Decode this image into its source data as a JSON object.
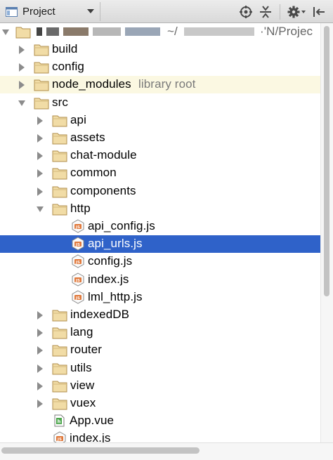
{
  "toolbar": {
    "view_title": "Project",
    "icons": [
      "project-window-icon",
      "chevron-down-icon",
      "crosshair-icon",
      "collapse-icon",
      "gear-icon",
      "hide-icon"
    ]
  },
  "tree": {
    "root_visible_suffix": "~/",
    "root_visible_tail": "·'N/Projec",
    "items": [
      {
        "label": "build",
        "type": "folder",
        "state": "collapsed"
      },
      {
        "label": "config",
        "type": "folder",
        "state": "collapsed"
      },
      {
        "label": "node_modules",
        "hint": "library root",
        "type": "folder",
        "state": "collapsed",
        "highlighted": true
      },
      {
        "label": "src",
        "type": "folder",
        "state": "expanded"
      },
      {
        "label": "api",
        "type": "folder",
        "state": "collapsed"
      },
      {
        "label": "assets",
        "type": "folder",
        "state": "collapsed"
      },
      {
        "label": "chat-module",
        "type": "folder",
        "state": "collapsed"
      },
      {
        "label": "common",
        "type": "folder",
        "state": "collapsed"
      },
      {
        "label": "components",
        "type": "folder",
        "state": "collapsed"
      },
      {
        "label": "http",
        "type": "folder",
        "state": "expanded"
      },
      {
        "label": "api_config.js",
        "type": "js"
      },
      {
        "label": "api_urls.js",
        "type": "js",
        "selected": true
      },
      {
        "label": "config.js",
        "type": "js"
      },
      {
        "label": "index.js",
        "type": "js"
      },
      {
        "label": "lml_http.js",
        "type": "js"
      },
      {
        "label": "indexedDB",
        "type": "folder",
        "state": "collapsed"
      },
      {
        "label": "lang",
        "type": "folder",
        "state": "collapsed"
      },
      {
        "label": "router",
        "type": "folder",
        "state": "collapsed"
      },
      {
        "label": "utils",
        "type": "folder",
        "state": "collapsed"
      },
      {
        "label": "view",
        "type": "folder",
        "state": "collapsed"
      },
      {
        "label": "vuex",
        "type": "folder",
        "state": "collapsed"
      },
      {
        "label": "App.vue",
        "type": "vue"
      },
      {
        "label": "index.js",
        "type": "js"
      }
    ]
  },
  "colors": {
    "selection": "#2f62c9",
    "library_highlight": "#fbf8e2",
    "folder": "#d9b877",
    "js_badge": "#e0783a"
  }
}
